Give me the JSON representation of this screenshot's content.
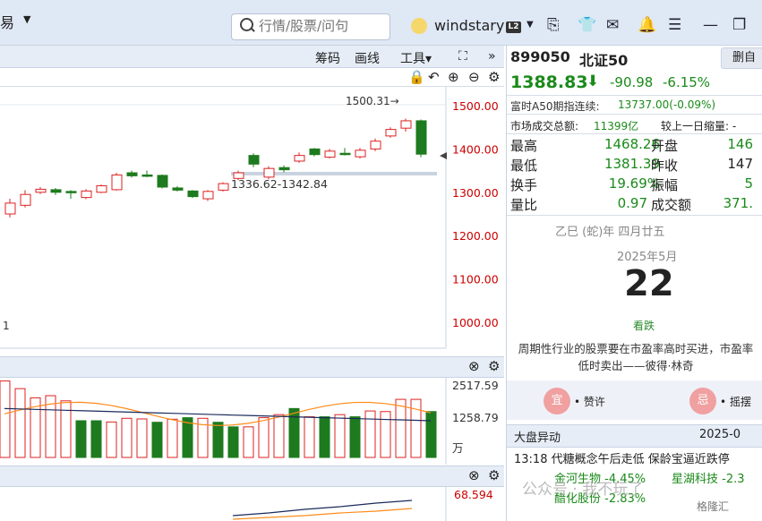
{
  "topbar": {
    "trade_label": "易",
    "search_placeholder": "行情/股票/问句",
    "username": "windstary",
    "level_badge": "L2",
    "icons": [
      "bookmark-icon",
      "shirt-icon",
      "mail-icon",
      "bell-icon",
      "menu-icon",
      "restore-icon"
    ]
  },
  "toolbar": {
    "chips": "筹码",
    "draw": "画线",
    "tools": "工具▾",
    "expand": "⛶",
    "more": "»"
  },
  "chart": {
    "price_ticks": [
      "1500.00",
      "1400.00",
      "1300.00",
      "1200.00",
      "1100.00",
      "1000.00"
    ],
    "high_marker": "1500.31→",
    "band_label": "1336.62-1342.84",
    "left_digit": "1",
    "vol_ticks": [
      "2517.59",
      "1258.79",
      "万"
    ],
    "ind_tick": "68.594"
  },
  "chart_data": {
    "type": "candlestick",
    "price_ylim": [
      1000,
      1500
    ],
    "candles": [
      {
        "o": 1250,
        "c": 1275,
        "h": 1285,
        "l": 1242
      },
      {
        "o": 1270,
        "c": 1295,
        "h": 1305,
        "l": 1265
      },
      {
        "o": 1300,
        "c": 1307,
        "h": 1312,
        "l": 1296
      },
      {
        "o": 1306,
        "c": 1300,
        "h": 1310,
        "l": 1294
      },
      {
        "o": 1302,
        "c": 1300,
        "h": 1305,
        "l": 1285
      },
      {
        "o": 1288,
        "c": 1303,
        "h": 1307,
        "l": 1284
      },
      {
        "o": 1300,
        "c": 1315,
        "h": 1318,
        "l": 1298
      },
      {
        "o": 1306,
        "c": 1340,
        "h": 1345,
        "l": 1304
      },
      {
        "o": 1345,
        "c": 1338,
        "h": 1350,
        "l": 1334
      },
      {
        "o": 1340,
        "c": 1338,
        "h": 1350,
        "l": 1335
      },
      {
        "o": 1339,
        "c": 1312,
        "h": 1341,
        "l": 1309
      },
      {
        "o": 1310,
        "c": 1305,
        "h": 1314,
        "l": 1302
      },
      {
        "o": 1303,
        "c": 1290,
        "h": 1305,
        "l": 1287
      },
      {
        "o": 1285,
        "c": 1302,
        "h": 1305,
        "l": 1280
      },
      {
        "o": 1305,
        "c": 1320,
        "h": 1323,
        "l": 1302
      },
      {
        "o": 1332,
        "c": 1345,
        "h": 1350,
        "l": 1328
      },
      {
        "o": 1385,
        "c": 1365,
        "h": 1390,
        "l": 1358
      },
      {
        "o": 1335,
        "c": 1355,
        "h": 1360,
        "l": 1330
      },
      {
        "o": 1357,
        "c": 1352,
        "h": 1362,
        "l": 1346
      },
      {
        "o": 1372,
        "c": 1385,
        "h": 1392,
        "l": 1368
      },
      {
        "o": 1400,
        "c": 1387,
        "h": 1402,
        "l": 1383
      },
      {
        "o": 1381,
        "c": 1395,
        "h": 1400,
        "l": 1378
      },
      {
        "o": 1390,
        "c": 1388,
        "h": 1402,
        "l": 1385
      },
      {
        "o": 1382,
        "c": 1397,
        "h": 1402,
        "l": 1378
      },
      {
        "o": 1400,
        "c": 1418,
        "h": 1424,
        "l": 1395
      },
      {
        "o": 1430,
        "c": 1445,
        "h": 1450,
        "l": 1426
      },
      {
        "o": 1448,
        "c": 1465,
        "h": 1470,
        "l": 1440
      },
      {
        "o": 1465,
        "c": 1388,
        "h": 1468,
        "l": 1381
      }
    ],
    "vol_ylim": [
      0,
      2517.59
    ],
    "volume": [
      2500,
      2250,
      1950,
      2020,
      1850,
      1200,
      1200,
      1160,
      1280,
      1260,
      1150,
      1250,
      1300,
      1280,
      1150,
      1000,
      1000,
      1300,
      1400,
      1600,
      1330,
      1330,
      1400,
      1330,
      1520,
      1500,
      1900,
      1900,
      1500
    ],
    "vol_up": [
      true,
      true,
      true,
      true,
      true,
      false,
      false,
      true,
      true,
      true,
      false,
      true,
      false,
      true,
      false,
      false,
      true,
      true,
      true,
      false,
      true,
      false,
      true,
      false,
      true,
      true,
      true,
      true,
      false
    ]
  },
  "right": {
    "code": "899050",
    "name": "北证50",
    "delete": "删自",
    "price": "1388.83",
    "change": "-90.98",
    "pct": "-6.15%",
    "a50_label": "富时A50期指连续:",
    "a50_value": "13737.00(-0.09%)",
    "turnover_label": "市场成交总额:",
    "turnover_value": "11399亿",
    "shrink_label": "较上一日缩量: -",
    "quotes": [
      {
        "l1": "最高",
        "v1": "1468.26",
        "l2": "开盘",
        "v2": "146"
      },
      {
        "l1": "最低",
        "v1": "1381.39",
        "l2": "昨收",
        "v2": "147"
      },
      {
        "l1": "换手",
        "v1": "19.69%",
        "l2": "振幅",
        "v2": "5"
      },
      {
        "l1": "量比",
        "v1": "0.97",
        "l2": "成交额",
        "v2": "371."
      }
    ],
    "lunar": "乙巳 (蛇)年 四月廿五",
    "yearmonth": "2025年5月",
    "day": "22",
    "daytip": "看跌",
    "quote_text": "周期性行业的股票要在市盈率高时买进，市盈率低时卖出——彼得·林奇",
    "yi": "宜",
    "yi_text": "• 赞许",
    "ji": "忌",
    "ji_text": "• 摇摆",
    "news_title": "大盘异动",
    "news_date": "2025-0",
    "news_head": "13:18 代糖概念午后走低 保龄宝逼近跌停",
    "tags": [
      {
        "name": "金河生物",
        "pct": "-4.45%"
      },
      {
        "name": "星湖科技",
        "pct": "-2.3"
      },
      {
        "name": "醋化股份",
        "pct": "-2.83%"
      }
    ],
    "watermark": "公众号 · 我不玩了",
    "watermark2": "格隆汇"
  }
}
